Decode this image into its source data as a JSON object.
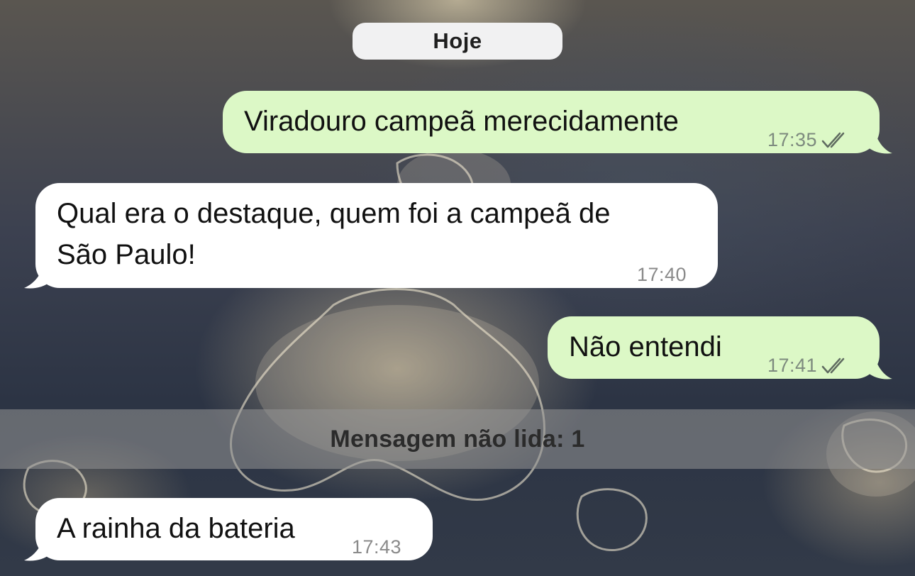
{
  "date_separator": "Hoje",
  "messages": [
    {
      "direction": "out",
      "text": "Viradouro campeã merecidamente",
      "time": "17:35",
      "status": "read-double-check-icon"
    },
    {
      "direction": "in",
      "line1": "Qual era o destaque, quem foi a campeã de",
      "line2": "São Paulo!",
      "time": "17:40"
    },
    {
      "direction": "out",
      "text": "Não entendi",
      "time": "17:41",
      "status": "read-double-check-icon"
    },
    {
      "direction": "in",
      "text": "A rainha da bateria",
      "time": "17:43"
    }
  ],
  "unread_banner": "Mensagem não lida: 1",
  "colors": {
    "outgoing_bubble": "#dcf8c6",
    "incoming_bubble": "#ffffff",
    "date_pill": "#f1f1f2"
  }
}
